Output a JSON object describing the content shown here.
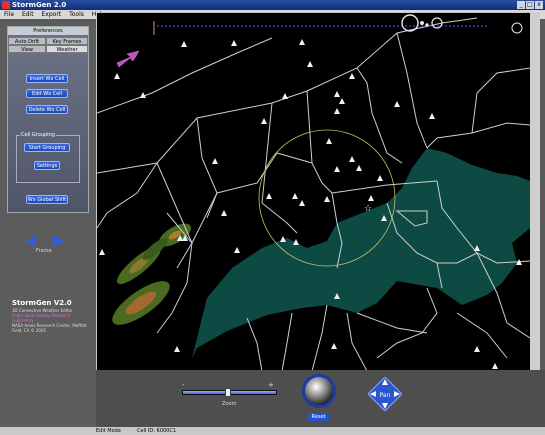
{
  "window": {
    "title": "StormGen 2.0",
    "controls": [
      "_",
      "□",
      "x"
    ]
  },
  "menu": [
    "File",
    "Edit",
    "Export",
    "Tools",
    "Help"
  ],
  "preferences": {
    "header": "Preferences",
    "tabs_top": [
      "Auto Drift",
      "Key Frames"
    ],
    "tabs_bottom": [
      "View",
      "Weather"
    ],
    "active_tab": "Weather",
    "buttons": [
      "Insert Wx Cell",
      "Edit Wx Cell",
      "Delete Wx Cell"
    ],
    "cell_grouping": {
      "label": "Cell Grouping",
      "buttons": [
        "Start Grouping",
        "Settings"
      ]
    },
    "global_button": "Wx Global Shift"
  },
  "frame": {
    "label": "Frame"
  },
  "app_info": {
    "name": "StormGen V2.0",
    "subtitle": "3D Convective Weather Editor",
    "credits": "Flight Deck Display Research Laboratory",
    "org": "NASA Ames Research Center, Moffett Field, CA © 2005"
  },
  "zoom": {
    "label": "Zoom",
    "minus": "-",
    "plus": "+",
    "level": 0.48
  },
  "reset": {
    "label": "Reset"
  },
  "pan": {
    "label": "Pan"
  },
  "status": {
    "mode": "Edit Mode",
    "cell_id": "Cell ID: K000C1"
  },
  "colors": {
    "button_blue": "#2a57d0",
    "weather_teal": "#0e4a44",
    "route_blue": "#3a4ad8"
  },
  "map": {
    "icons": [
      "wind-arrow-icon",
      "circle-symbols-icon",
      "station-triangle-icon",
      "selected-star-icon"
    ]
  }
}
